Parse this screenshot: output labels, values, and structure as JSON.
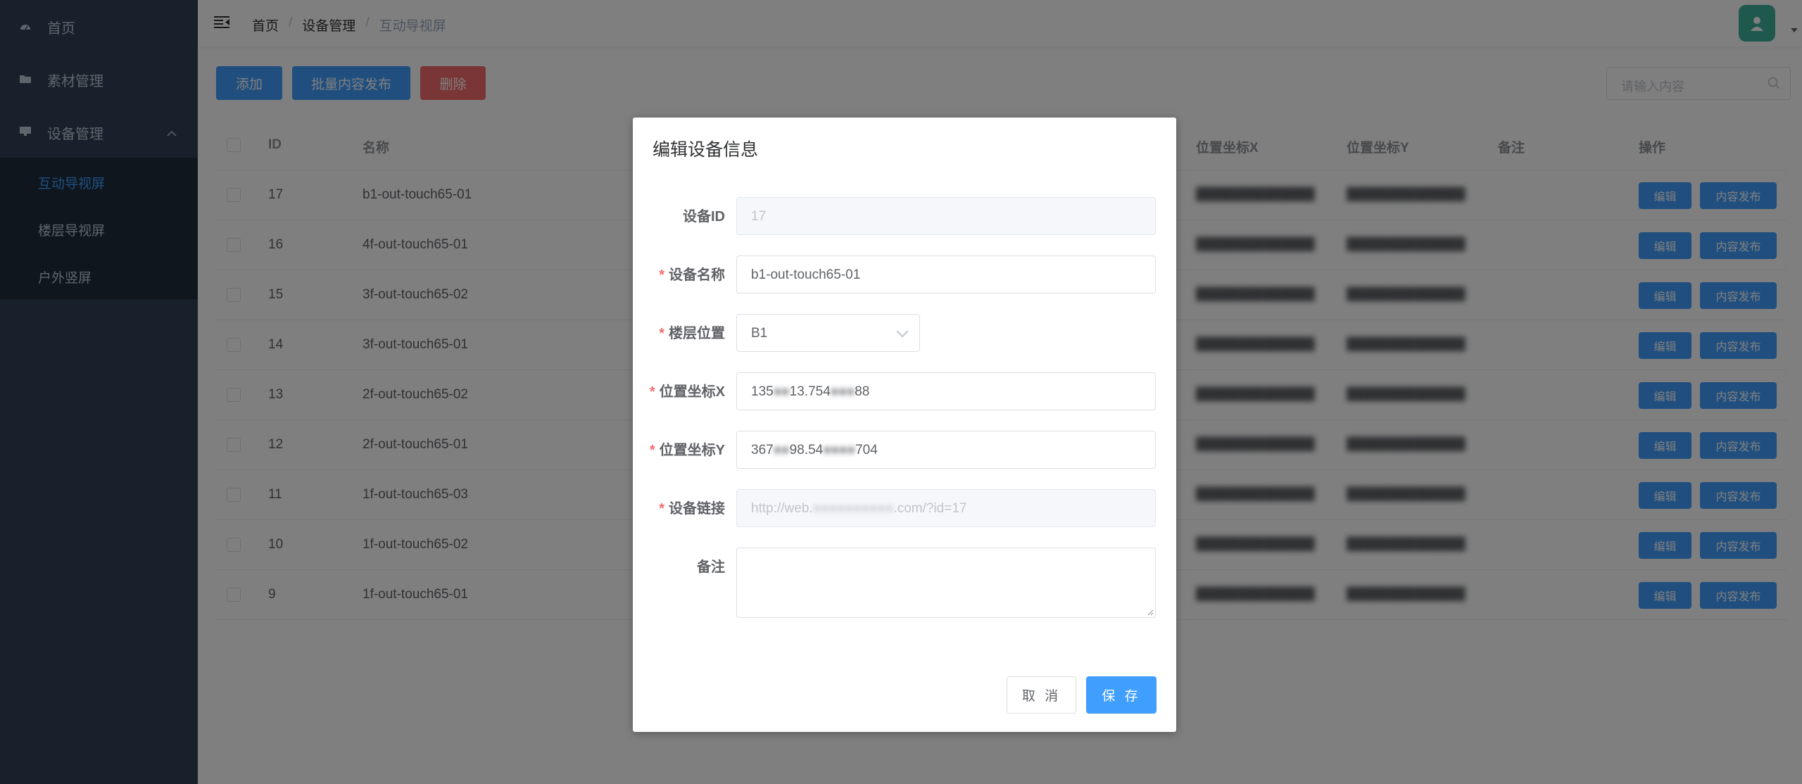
{
  "sidebar": {
    "items": [
      {
        "label": "首页",
        "icon": "dashboard-icon"
      },
      {
        "label": "素材管理",
        "icon": "folder-icon"
      },
      {
        "label": "设备管理",
        "icon": "monitor-icon"
      }
    ],
    "submenu": [
      {
        "label": "互动导视屏",
        "active": true
      },
      {
        "label": "楼层导视屏",
        "active": false
      },
      {
        "label": "户外竖屏",
        "active": false
      }
    ]
  },
  "header": {
    "breadcrumb": [
      "首页",
      "设备管理",
      "互动导视屏"
    ],
    "separator": "/"
  },
  "toolbar": {
    "add_label": "添加",
    "batch_publish_label": "批量内容发布",
    "delete_label": "删除",
    "search_placeholder": "请输入内容"
  },
  "table": {
    "columns": [
      "ID",
      "名称",
      "位置坐标X",
      "位置坐标Y",
      "备注",
      "操作"
    ],
    "rows": [
      {
        "id": "17",
        "name": "b1-out-touch65-01"
      },
      {
        "id": "16",
        "name": "4f-out-touch65-01"
      },
      {
        "id": "15",
        "name": "3f-out-touch65-02"
      },
      {
        "id": "14",
        "name": "3f-out-touch65-01"
      },
      {
        "id": "13",
        "name": "2f-out-touch65-02"
      },
      {
        "id": "12",
        "name": "2f-out-touch65-01"
      },
      {
        "id": "11",
        "name": "1f-out-touch65-03"
      },
      {
        "id": "10",
        "name": "1f-out-touch65-02"
      },
      {
        "id": "9",
        "name": "1f-out-touch65-01"
      }
    ],
    "edit_label": "编辑",
    "publish_label": "内容发布"
  },
  "dialog": {
    "title": "编辑设备信息",
    "fields": {
      "device_id": {
        "label": "设备ID",
        "value": "17"
      },
      "device_name": {
        "label": "设备名称",
        "value": "b1-out-touch65-01"
      },
      "floor": {
        "label": "楼层位置",
        "value": "B1"
      },
      "coord_x": {
        "label": "位置坐标X",
        "prefix": "135",
        "mid": "13.754",
        "suffix": "88"
      },
      "coord_y": {
        "label": "位置坐标Y",
        "prefix": "367",
        "mid": "98.54",
        "suffix": "704"
      },
      "link": {
        "label": "设备链接",
        "prefix": "http://web.",
        "suffix": ".com/?id=17"
      },
      "remark": {
        "label": "备注",
        "value": ""
      }
    },
    "required_mark": "*",
    "cancel_label": "取 消",
    "save_label": "保 存"
  },
  "colors": {
    "sidebar_bg": "#304156",
    "submenu_bg": "#1f2d3d",
    "primary": "#409eff",
    "danger": "#f56c6c",
    "avatar": "#3fb39a"
  }
}
